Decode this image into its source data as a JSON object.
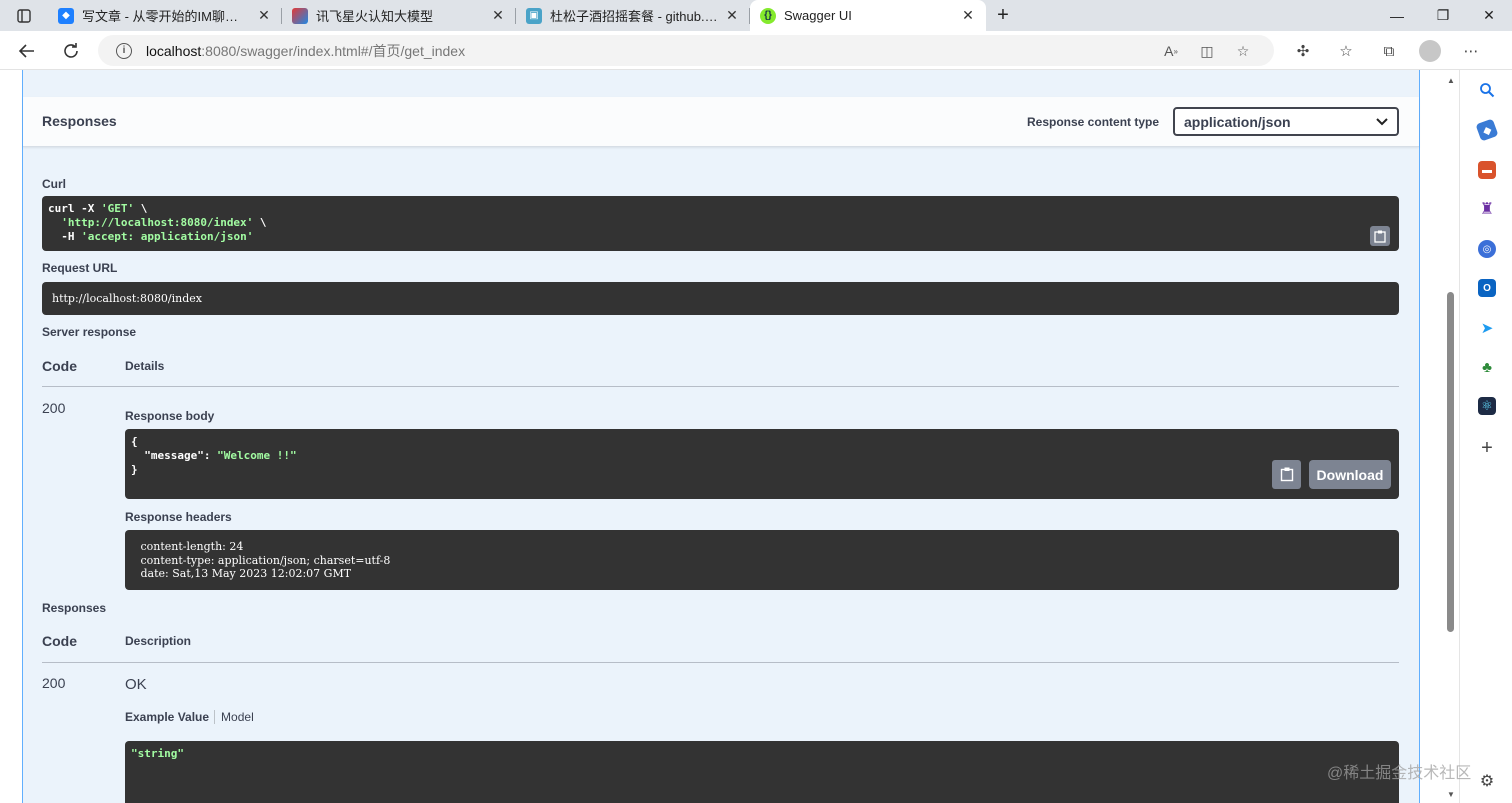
{
  "browser": {
    "tabs": [
      {
        "title": "写文章 - 从零开始的IM聊天系统",
        "active": false
      },
      {
        "title": "讯飞星火认知大模型",
        "active": false
      },
      {
        "title": "杜松子酒招摇套餐 - github.com/",
        "active": false
      },
      {
        "title": "Swagger UI",
        "active": true
      }
    ],
    "url_host": "localhost",
    "url_rest": ":8080/swagger/index.html#/首页/get_index",
    "new_tab_symbol": "+",
    "close_symbol": "✕"
  },
  "responses_section": {
    "title": "Responses",
    "content_type_label": "Response content type",
    "content_type_value": "application/json"
  },
  "curl": {
    "label": "Curl",
    "line1_cmd": "curl -X ",
    "line1_method": "'GET'",
    "line1_tail": " \\",
    "line2_pad": "  ",
    "line2_url": "'http://localhost:8080/index'",
    "line2_tail": " \\",
    "line3_flag": "  -H ",
    "line3_header": "'accept: application/json'"
  },
  "request_url": {
    "label": "Request URL",
    "value": "http://localhost:8080/index"
  },
  "server_response": {
    "label": "Server response",
    "code_header": "Code",
    "details_header": "Details",
    "code": "200",
    "body_label": "Response body",
    "body_open": "{",
    "body_key": "  \"message\": ",
    "body_value": "\"Welcome !!\"",
    "body_close": "}",
    "download_label": "Download",
    "headers_label": "Response headers",
    "headers": [
      " content-length: 24 ",
      " content-type: application/json; charset=utf-8 ",
      " date: Sat,13 May 2023 12:02:07 GMT "
    ]
  },
  "responses_table": {
    "label": "Responses",
    "code_header": "Code",
    "description_header": "Description",
    "code": "200",
    "description": "OK",
    "example_tab": "Example Value",
    "model_tab": "Model",
    "example_value": "\"string\""
  },
  "watermark": "@稀土掘金技术社区",
  "colors": {
    "get_border": "#61affe",
    "get_bg": "#ebf3fb",
    "code_bg": "#333333",
    "string_green": "#a2fca2",
    "button_gray": "#7d8492"
  }
}
